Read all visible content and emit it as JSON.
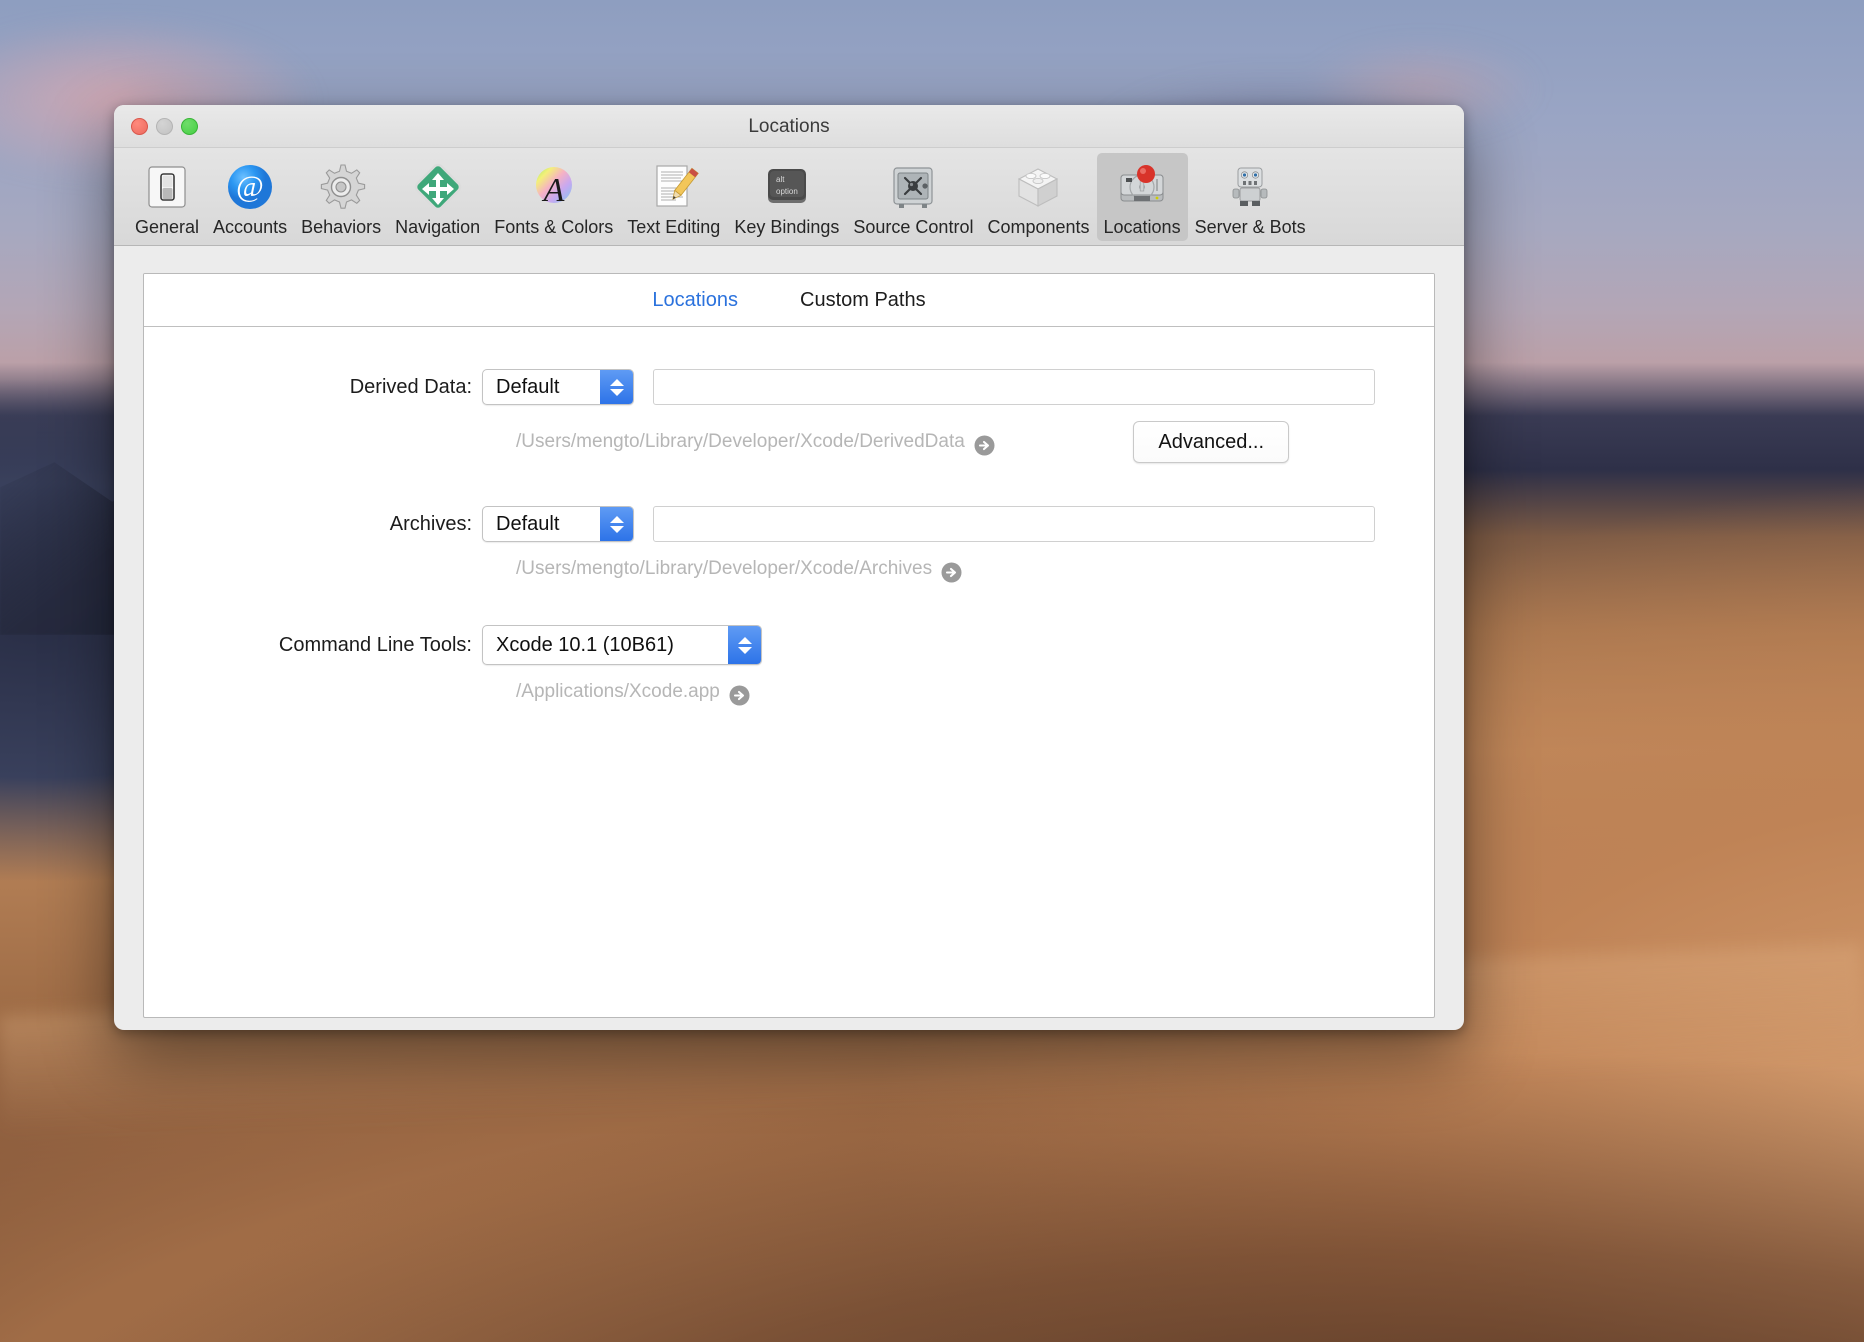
{
  "window": {
    "title": "Locations",
    "traffic_lights": [
      "close",
      "minimize",
      "maximize"
    ]
  },
  "toolbar": {
    "items": [
      {
        "id": "general",
        "label": "General",
        "icon": "switch-icon",
        "selected": false
      },
      {
        "id": "accounts",
        "label": "Accounts",
        "icon": "at-sign-icon",
        "selected": false
      },
      {
        "id": "behaviors",
        "label": "Behaviors",
        "icon": "gear-icon",
        "selected": false
      },
      {
        "id": "navigation",
        "label": "Navigation",
        "icon": "move-arrows-icon",
        "selected": false
      },
      {
        "id": "fonts-colors",
        "label": "Fonts & Colors",
        "icon": "font-color-icon",
        "selected": false
      },
      {
        "id": "text-editing",
        "label": "Text Editing",
        "icon": "document-pencil-icon",
        "selected": false
      },
      {
        "id": "key-bindings",
        "label": "Key Bindings",
        "icon": "alt-option-key-icon",
        "selected": false
      },
      {
        "id": "source-control",
        "label": "Source Control",
        "icon": "safe-vault-icon",
        "selected": false
      },
      {
        "id": "components",
        "label": "Components",
        "icon": "package-box-icon",
        "selected": false
      },
      {
        "id": "locations",
        "label": "Locations",
        "icon": "hard-drive-pin-icon",
        "selected": true
      },
      {
        "id": "server-bots",
        "label": "Server & Bots",
        "icon": "robot-icon",
        "selected": false
      }
    ]
  },
  "tabs": [
    {
      "id": "locations",
      "label": "Locations",
      "active": true
    },
    {
      "id": "custom-paths",
      "label": "Custom Paths",
      "active": false
    }
  ],
  "form": {
    "derived_data": {
      "label": "Derived Data:",
      "popup_value": "Default",
      "field_value": "",
      "path": "/Users/mengto/Library/Developer/Xcode/DerivedData"
    },
    "advanced_button": "Advanced...",
    "archives": {
      "label": "Archives:",
      "popup_value": "Default",
      "field_value": "",
      "path": "/Users/mengto/Library/Developer/Xcode/Archives"
    },
    "command_line_tools": {
      "label": "Command Line Tools:",
      "popup_value": "Xcode 10.1 (10B61)",
      "path": "/Applications/Xcode.app"
    }
  },
  "colors": {
    "accent_blue": "#2b72dd",
    "stepper_blue": "#2d73e8",
    "path_gray": "#b6b6b6",
    "toolbar_selected": "#c6c6c6"
  }
}
